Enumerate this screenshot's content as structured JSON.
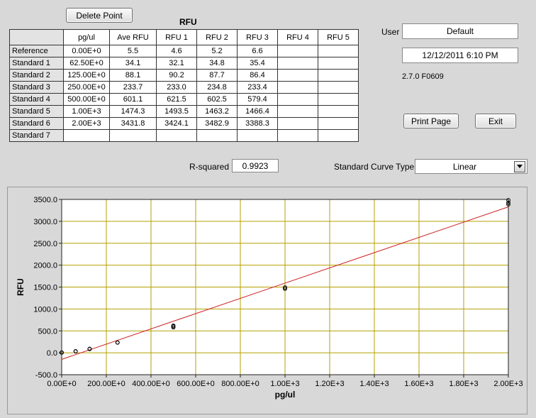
{
  "toolbar": {
    "delete_point_label": "Delete Point"
  },
  "table": {
    "title": "RFU",
    "columns": [
      "pg/ul",
      "Ave RFU",
      "RFU 1",
      "RFU 2",
      "RFU 3",
      "RFU 4",
      "RFU 5"
    ],
    "rows": [
      {
        "name": "Reference",
        "cells": [
          "0.00E+0",
          "5.5",
          "4.6",
          "5.2",
          "6.6",
          "",
          ""
        ]
      },
      {
        "name": "Standard 1",
        "cells": [
          "62.50E+0",
          "34.1",
          "32.1",
          "34.8",
          "35.4",
          "",
          ""
        ]
      },
      {
        "name": "Standard 2",
        "cells": [
          "125.00E+0",
          "88.1",
          "90.2",
          "87.7",
          "86.4",
          "",
          ""
        ]
      },
      {
        "name": "Standard 3",
        "cells": [
          "250.00E+0",
          "233.7",
          "233.0",
          "234.8",
          "233.4",
          "",
          ""
        ]
      },
      {
        "name": "Standard 4",
        "cells": [
          "500.00E+0",
          "601.1",
          "621.5",
          "602.5",
          "579.4",
          "",
          ""
        ]
      },
      {
        "name": "Standard 5",
        "cells": [
          "1.00E+3",
          "1474.3",
          "1493.5",
          "1463.2",
          "1466.4",
          "",
          ""
        ]
      },
      {
        "name": "Standard 6",
        "cells": [
          "2.00E+3",
          "3431.8",
          "3424.1",
          "3482.9",
          "3388.3",
          "",
          ""
        ]
      },
      {
        "name": "Standard 7",
        "cells": [
          "",
          "",
          "",
          "",
          "",
          "",
          ""
        ]
      }
    ]
  },
  "user": {
    "label": "User",
    "value": "Default"
  },
  "datetime": "12/12/2011  6:10 PM",
  "version": "2.7.0 F0609",
  "buttons": {
    "print_label": "Print Page",
    "exit_label": "Exit"
  },
  "rsquared": {
    "label": "R-squared",
    "value": "0.9923"
  },
  "curve_type": {
    "label": "Standard Curve Type",
    "value": "Linear"
  },
  "colors": {
    "grid": "#b4a000",
    "fit_line": "#cc2222",
    "plot_bg": "#ffffff",
    "panel_bg": "#d8d8d8"
  },
  "chart_data": {
    "type": "scatter",
    "xlabel": "pg/ul",
    "ylabel": "RFU",
    "xlim": [
      0,
      2000
    ],
    "ylim": [
      -500,
      3500
    ],
    "grid": true,
    "x_ticks": [
      {
        "v": 0,
        "label": "0.00E+0"
      },
      {
        "v": 200,
        "label": "200.00E+0"
      },
      {
        "v": 400,
        "label": "400.00E+0"
      },
      {
        "v": 600,
        "label": "600.00E+0"
      },
      {
        "v": 800,
        "label": "800.00E+0"
      },
      {
        "v": 1000,
        "label": "1.00E+3"
      },
      {
        "v": 1200,
        "label": "1.20E+3"
      },
      {
        "v": 1400,
        "label": "1.40E+3"
      },
      {
        "v": 1600,
        "label": "1.60E+3"
      },
      {
        "v": 1800,
        "label": "1.80E+3"
      },
      {
        "v": 2000,
        "label": "2.00E+3"
      }
    ],
    "y_ticks": [
      {
        "v": 3500,
        "label": "3500.0"
      },
      {
        "v": 3000,
        "label": "3000.0"
      },
      {
        "v": 2500,
        "label": "2500.0"
      },
      {
        "v": 2000,
        "label": "2000.0"
      },
      {
        "v": 1500,
        "label": "1500.0"
      },
      {
        "v": 1000,
        "label": "1000.0"
      },
      {
        "v": 500,
        "label": "500.0"
      },
      {
        "v": 0,
        "label": "0.0"
      },
      {
        "v": -500,
        "label": "-500.0"
      }
    ],
    "points": [
      [
        0,
        4.6
      ],
      [
        0,
        5.2
      ],
      [
        0,
        6.6
      ],
      [
        62.5,
        32.1
      ],
      [
        62.5,
        34.8
      ],
      [
        62.5,
        35.4
      ],
      [
        125,
        90.2
      ],
      [
        125,
        87.7
      ],
      [
        125,
        86.4
      ],
      [
        250,
        233.0
      ],
      [
        250,
        234.8
      ],
      [
        250,
        233.4
      ],
      [
        500,
        621.5
      ],
      [
        500,
        602.5
      ],
      [
        500,
        579.4
      ],
      [
        1000,
        1493.5
      ],
      [
        1000,
        1463.2
      ],
      [
        1000,
        1466.4
      ],
      [
        2000,
        3424.1
      ],
      [
        2000,
        3482.9
      ],
      [
        2000,
        3388.3
      ]
    ],
    "fit_line": [
      [
        0,
        -150
      ],
      [
        2000,
        3330
      ]
    ]
  }
}
